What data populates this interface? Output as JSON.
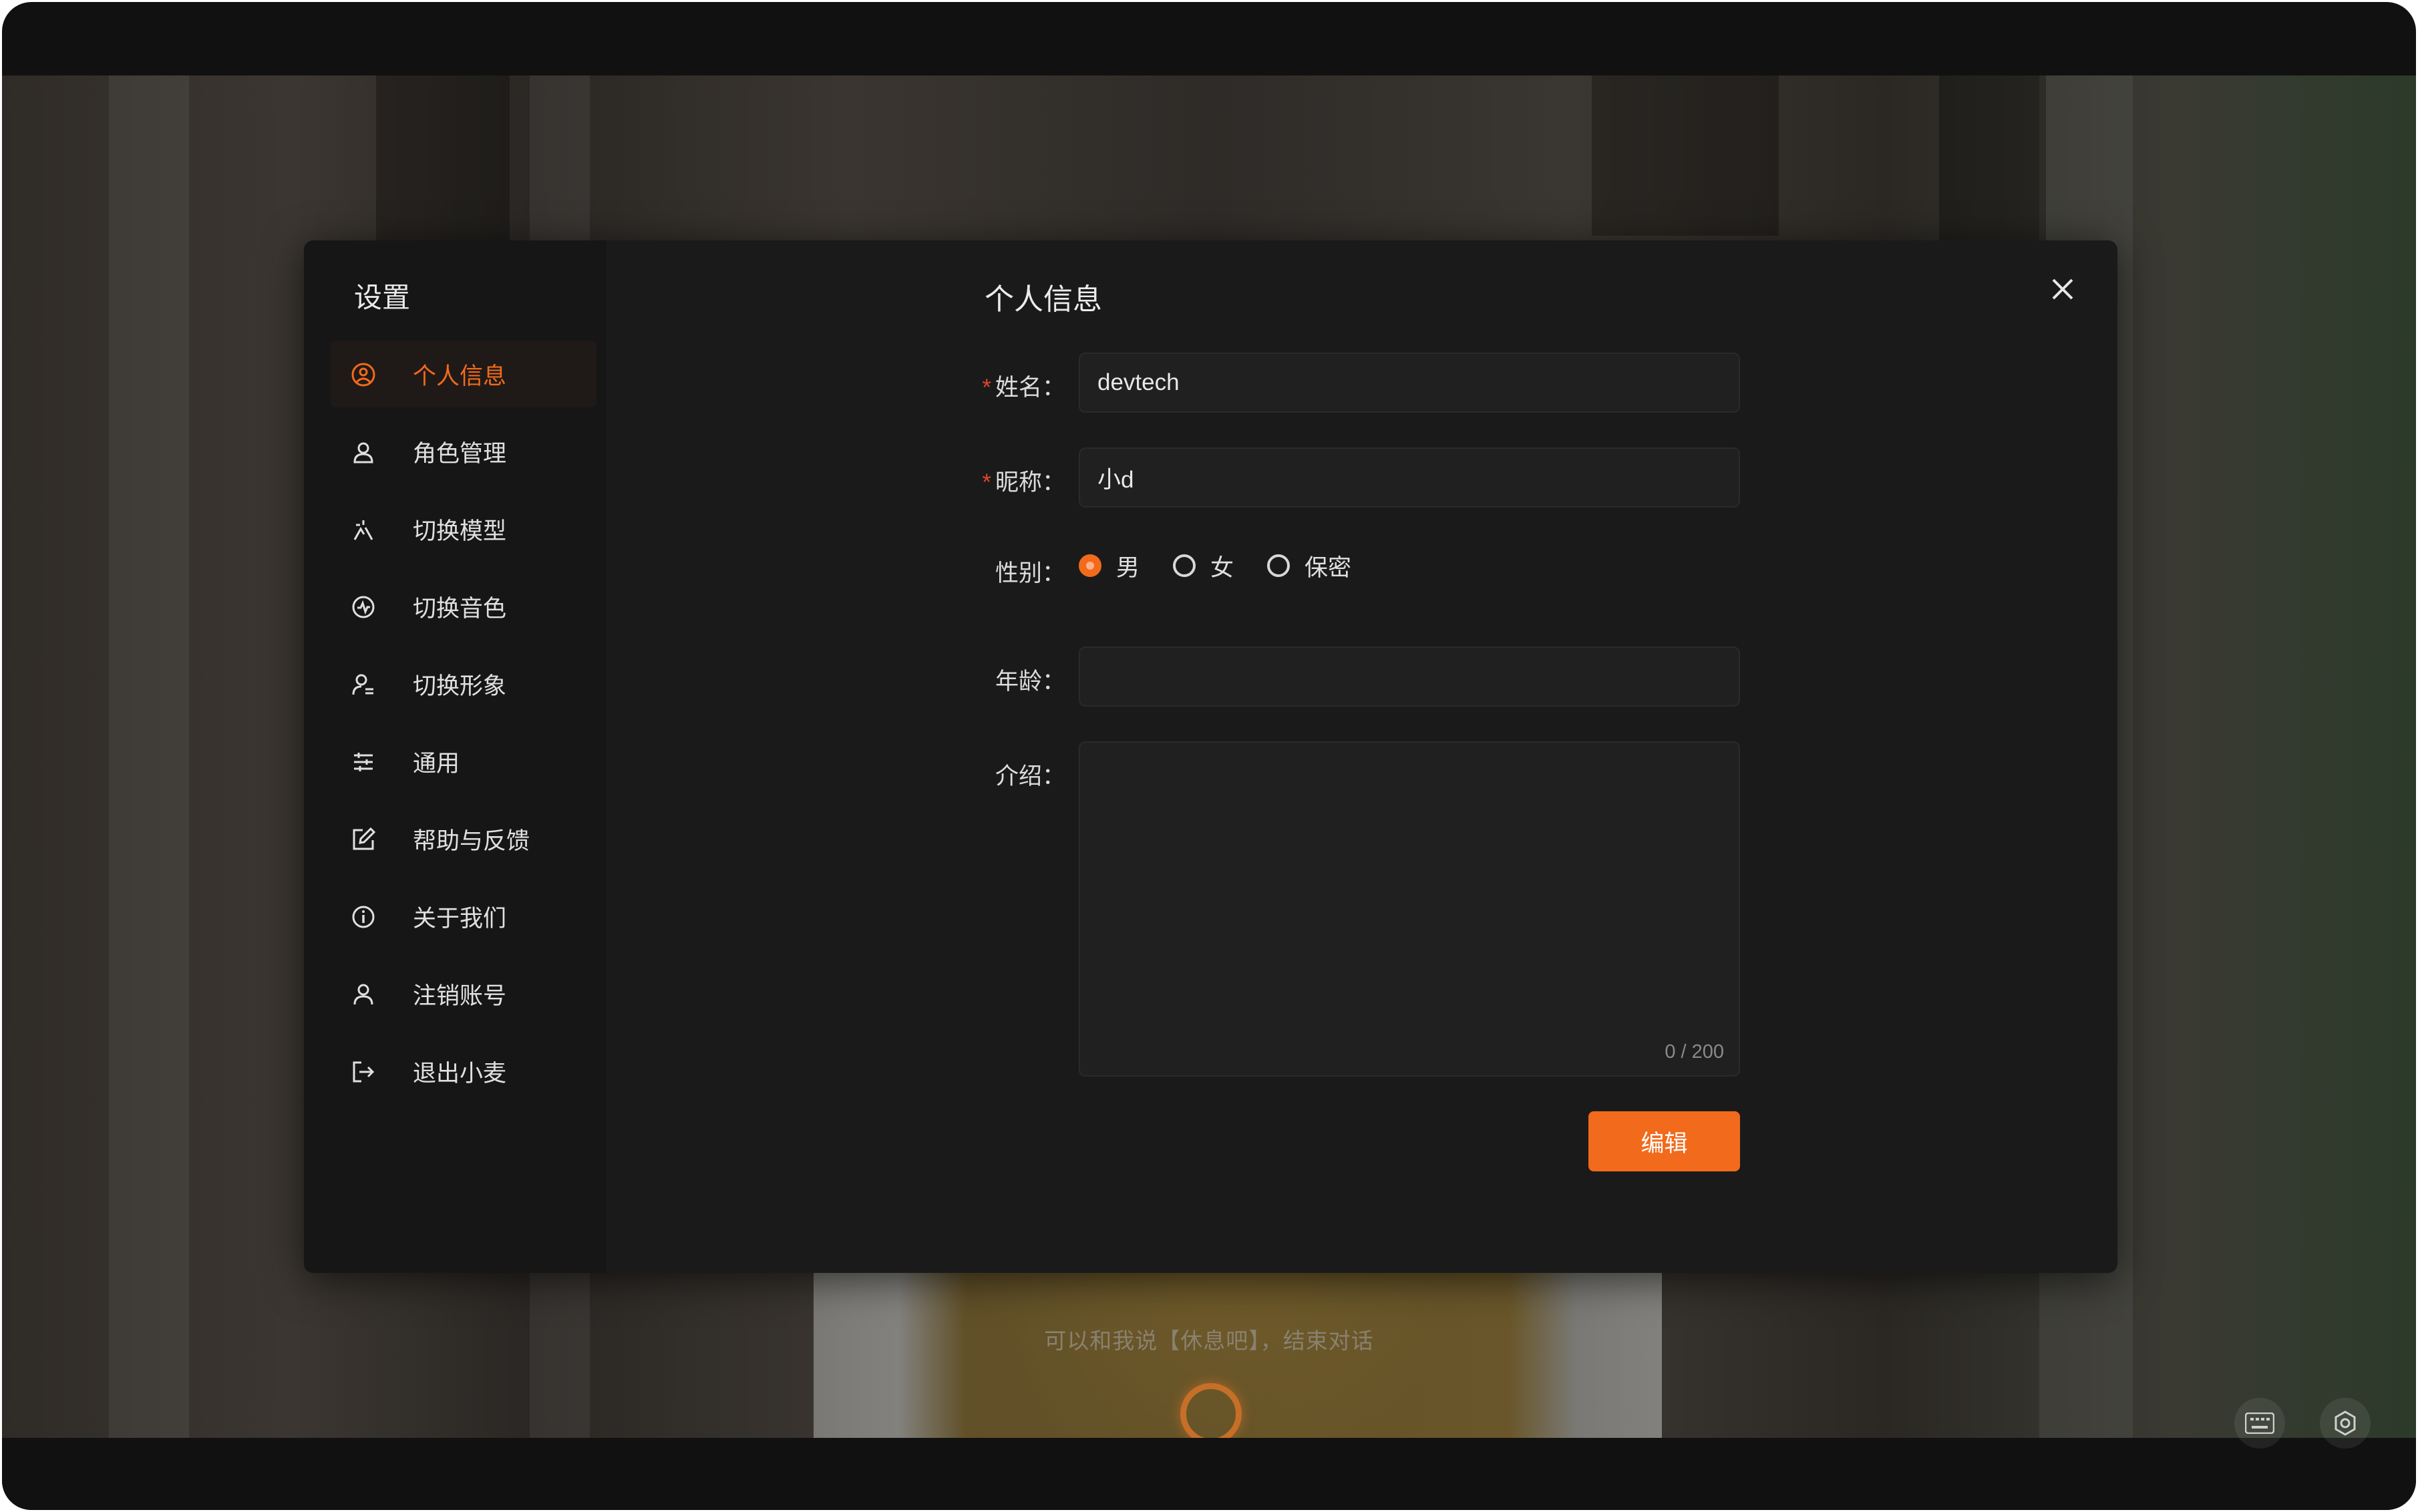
{
  "colors": {
    "accent": "#f26a1b",
    "modal_bg": "#1a1a1a",
    "sidebar_bg": "#161616",
    "required": "#e0452b"
  },
  "background": {
    "subtitle": "可以和我说【休息吧】，结束对话"
  },
  "sidebar": {
    "title": "设置",
    "items": [
      {
        "label": "个人信息",
        "icon": "user-circle-icon",
        "active": true
      },
      {
        "label": "角色管理",
        "icon": "user-icon"
      },
      {
        "label": "切换模型",
        "icon": "model-switch-icon"
      },
      {
        "label": "切换音色",
        "icon": "voice-switch-icon"
      },
      {
        "label": "切换形象",
        "icon": "avatar-switch-icon"
      },
      {
        "label": "通用",
        "icon": "sliders-icon"
      },
      {
        "label": "帮助与反馈",
        "icon": "edit-icon"
      },
      {
        "label": "关于我们",
        "icon": "info-icon"
      },
      {
        "label": "注销账号",
        "icon": "user-remove-icon"
      },
      {
        "label": "退出小麦",
        "icon": "logout-icon"
      }
    ]
  },
  "form": {
    "title": "个人信息",
    "name": {
      "label": "姓名：",
      "value": "devtech",
      "required": true
    },
    "nickname": {
      "label": "昵称：",
      "value": "小d",
      "required": true
    },
    "gender": {
      "label": "性别：",
      "options": [
        "男",
        "女",
        "保密"
      ],
      "selected": "男"
    },
    "age": {
      "label": "年龄：",
      "value": ""
    },
    "intro": {
      "label": "介绍：",
      "value": "",
      "counter": "0 / 200"
    },
    "submit_label": "编辑"
  }
}
